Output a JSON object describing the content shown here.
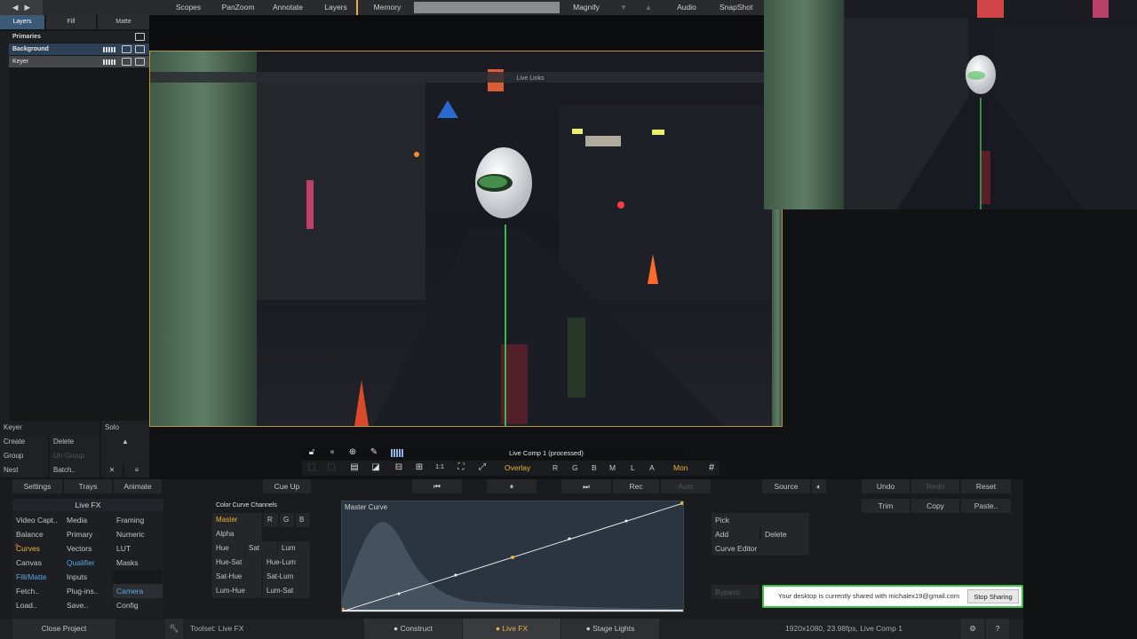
{
  "topbar": {
    "items": [
      "Scopes",
      "PanZoom",
      "Annotate",
      "Layers",
      "Memory",
      "Magnify",
      "Audio",
      "SnapShot"
    ]
  },
  "left_panel": {
    "tabs": [
      "Layers",
      "Fill",
      "Matte"
    ],
    "layers": [
      "Primaries",
      "Background",
      "Keyer"
    ],
    "selected_layer": "Keyer",
    "solo_label": "Solo",
    "create_label": "Create",
    "delete_label": "Delete",
    "group_label": "Group",
    "ungroup_label": "Un-Group",
    "nest_label": "Nest",
    "batch_label": "Batch.."
  },
  "viewer": {
    "live_links": "Live Links",
    "overlay_bar_label": "Live Comp 1 (processed)",
    "toolbar": {
      "overlay": "Overlay",
      "channels": [
        "R",
        "G",
        "B",
        "M",
        "L",
        "A"
      ],
      "mon": "Mon"
    }
  },
  "transport": {
    "settings": "Settings",
    "trays": "Trays",
    "animate": "Animate",
    "cue_up": "Cue Up",
    "rec": "Rec",
    "auto": "Auto",
    "source": "Source",
    "undo": "Undo",
    "redo": "Redo",
    "reset": "Reset"
  },
  "fx_panel": {
    "title": "Live FX",
    "grid": [
      [
        "Video Capt..",
        "Media",
        "Framing"
      ],
      [
        "Balance",
        "Primary",
        "Numeric"
      ],
      [
        "Curves",
        "Vectors",
        "LUT"
      ],
      [
        "Canvas",
        "Qualifier",
        "Masks"
      ],
      [
        "Fill/Matte",
        "Inputs",
        ""
      ],
      [
        "Fetch..",
        "Plug-ins..",
        "Camera"
      ],
      [
        "Load..",
        "Save..",
        "Config"
      ]
    ],
    "highlight_color": "#5aa8e8"
  },
  "curve_channels": {
    "title": "Color Curve Channels",
    "master": "Master",
    "rgb": [
      "R",
      "G",
      "B"
    ],
    "alpha": "Alpha",
    "hsl": [
      "Hue",
      "Sat",
      "Lum"
    ],
    "rows": [
      [
        "Hue-Sat",
        "Hue-Lum"
      ],
      [
        "Sat-Hue",
        "Sat-Lum"
      ],
      [
        "Lum-Hue",
        "Lum-Sat"
      ]
    ],
    "accent_color": "#e8b33a"
  },
  "curve_graph": {
    "title": "Master Curve"
  },
  "curve_actions": {
    "trim": "Trim",
    "copy": "Copy",
    "paste": "Paste..",
    "pick": "Pick",
    "add": "Add",
    "delete": "Delete",
    "editor": "Curve Editor",
    "bypass": "Bypass"
  },
  "share_notice": {
    "text": "Your desktop is currently shared with michalex19@gmail.com",
    "stop": "Stop Sharing"
  },
  "footer": {
    "close_project": "Close Project",
    "toolset": "Toolset: Live FX",
    "tabs": [
      "Construct",
      "Live FX",
      "Stage Lights"
    ],
    "active_tab": "Live FX",
    "status": "1920x1080, 23.98fps, Live Comp 1",
    "help": "?"
  }
}
